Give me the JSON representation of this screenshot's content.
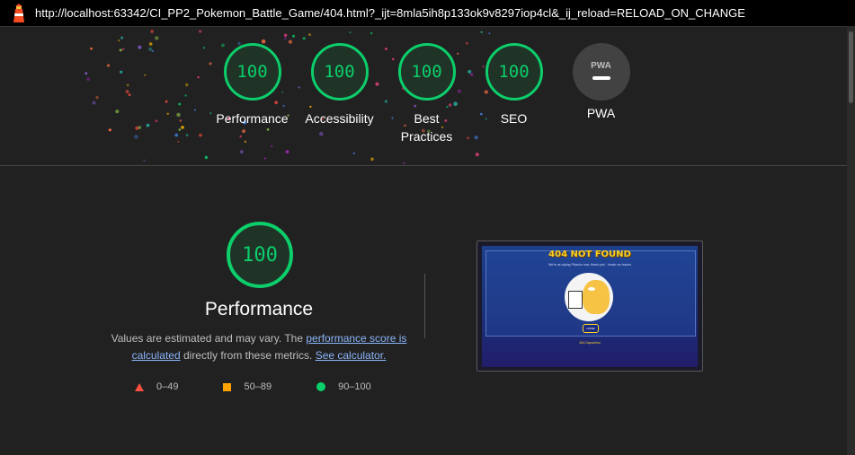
{
  "browser": {
    "url": "http://localhost:63342/CI_PP2_Pokemon_Battle_Game/404.html?_ijt=8mla5ih8p133ok9v8297iop4cl&_ij_reload=RELOAD_ON_CHANGE"
  },
  "summary": {
    "gauges": [
      {
        "score": "100",
        "label": "Performance"
      },
      {
        "score": "100",
        "label": "Accessibility"
      },
      {
        "score": "100",
        "label": "Best Practices"
      },
      {
        "score": "100",
        "label": "SEO"
      }
    ],
    "pwa": {
      "badge": "PWA",
      "label": "PWA"
    }
  },
  "performance": {
    "score": "100",
    "title": "Performance",
    "desc_prefix": "Values are estimated and may vary. The ",
    "score_link": "performance score is calculated",
    "desc_middle": " directly from these metrics. ",
    "calc_link": "See calculator.",
    "legend": [
      {
        "range": "0–49",
        "color": "#ff4e42"
      },
      {
        "range": "50–89",
        "color": "#ffa400"
      },
      {
        "range": "90–100",
        "color": "#0cce6b"
      }
    ]
  },
  "screenshot": {
    "title": "404 NOT FOUND",
    "subtitle": "We're as wiping Pikachu now, thank you! · break our issues",
    "button": "HOME",
    "footer": "404 Capuchino"
  },
  "colors": {
    "pass": "#0cce6b",
    "average": "#ffa400",
    "fail": "#ff4e42",
    "link": "#8ab4f8"
  }
}
